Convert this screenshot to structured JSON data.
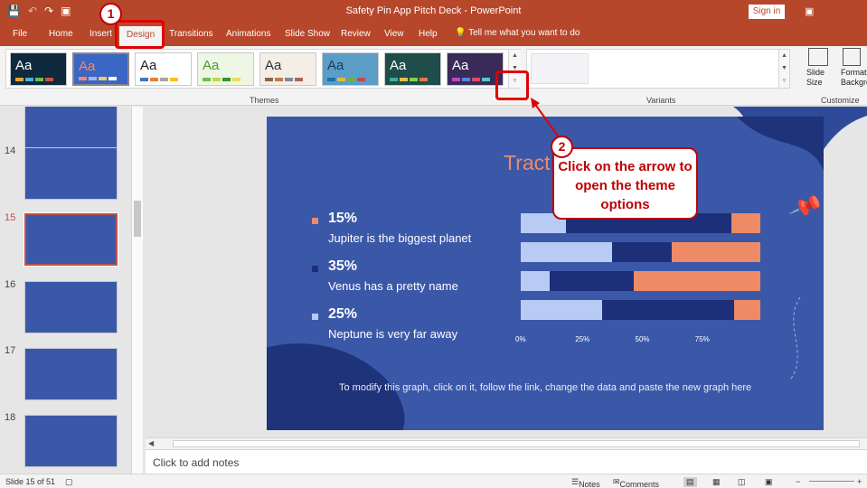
{
  "window": {
    "title": "Safety Pin App Pitch Deck  -  PowerPoint",
    "sign_in": "Sign in"
  },
  "tabs": [
    "File",
    "Home",
    "Insert",
    "Design",
    "Transitions",
    "Animations",
    "Slide Show",
    "Review",
    "View",
    "Help"
  ],
  "active_tab": "Design",
  "tell_me": "Tell me what you want to do",
  "ribbon": {
    "themes_label": "Themes",
    "variants_label": "Variants",
    "customize_label": "Customize",
    "slide_size": "Slide Size",
    "format_background": "Format Background",
    "theme_tiles": [
      {
        "aa": "Aa",
        "bg": "#0e2a3c",
        "fg": "#ffffff",
        "bars": [
          "#e8a33a",
          "#4db0d8",
          "#6cc04a",
          "#d0513b"
        ]
      },
      {
        "aa": "Aa",
        "bg": "#3c66c4",
        "fg": "#f08a6a",
        "bars": [
          "#f08a6a",
          "#9fb5f0",
          "#f0c56a",
          "#ffffff"
        ]
      },
      {
        "aa": "Aa",
        "bg": "#ffffff",
        "fg": "#222222",
        "bars": [
          "#4472c4",
          "#ed7d31",
          "#a5a5a5",
          "#ffc000"
        ]
      },
      {
        "aa": "Aa",
        "bg": "#eef6e5",
        "fg": "#4f9b2a",
        "bars": [
          "#6cc04a",
          "#c0d94a",
          "#3a8f3a",
          "#e8e04a"
        ]
      },
      {
        "aa": "Aa",
        "bg": "#f4eee6",
        "fg": "#333333",
        "bars": [
          "#8a6a4a",
          "#c07a4a",
          "#7a8a9a",
          "#b06060"
        ]
      },
      {
        "aa": "Aa",
        "bg": "#5a9ec8",
        "fg": "#1a3a5a",
        "bars": [
          "#1a6fb0",
          "#e8b83a",
          "#6ab04a",
          "#c04a4a"
        ]
      },
      {
        "aa": "Aa",
        "bg": "#1e4d4a",
        "fg": "#ffffff",
        "bars": [
          "#3ab0a0",
          "#e8c04a",
          "#8ad04a",
          "#e07a4a"
        ]
      },
      {
        "aa": "Aa",
        "bg": "#3a2a5a",
        "fg": "#ffffff",
        "bars": [
          "#c04ac0",
          "#4a8ae0",
          "#e04a6a",
          "#4ad0c0"
        ]
      }
    ]
  },
  "slides": [
    {
      "num": "",
      "visible_partial": true
    },
    {
      "num": "14"
    },
    {
      "num": "15",
      "selected": true
    },
    {
      "num": "16"
    },
    {
      "num": "17"
    },
    {
      "num": "18"
    }
  ],
  "slide": {
    "title": "Tract",
    "items": [
      {
        "pct": "15%",
        "desc": "Jupiter is the biggest planet",
        "color": "#ee8a66"
      },
      {
        "pct": "35%",
        "desc": "Venus has a pretty name",
        "color": "#1e2f7a"
      },
      {
        "pct": "25%",
        "desc": "Neptune is very far away",
        "color": "#b7cbf5"
      }
    ],
    "footer": "To modify this graph, click on it, follow the link, change the data and paste the new graph here"
  },
  "chart_data": {
    "type": "bar",
    "orientation": "horizontal",
    "stacked": true,
    "x_ticks": [
      "0%",
      "25%",
      "50%",
      "75%"
    ],
    "xlim": [
      0,
      100
    ],
    "rows": [
      {
        "segments": [
          19,
          69,
          12
        ]
      },
      {
        "segments": [
          38,
          25,
          37
        ]
      },
      {
        "segments": [
          12,
          35,
          53
        ]
      },
      {
        "segments": [
          34,
          55,
          11
        ]
      }
    ],
    "segment_colors": [
      "#b7cbf5",
      "#1e2f7a",
      "#ee8a66"
    ]
  },
  "notes_placeholder": "Click to add notes",
  "status": {
    "slide": "Slide 15 of 51",
    "notes": "Notes",
    "comments": "Comments"
  },
  "callouts": {
    "step1": "1",
    "step2": "2",
    "step2_text": "Click on the arrow to open the theme options"
  }
}
